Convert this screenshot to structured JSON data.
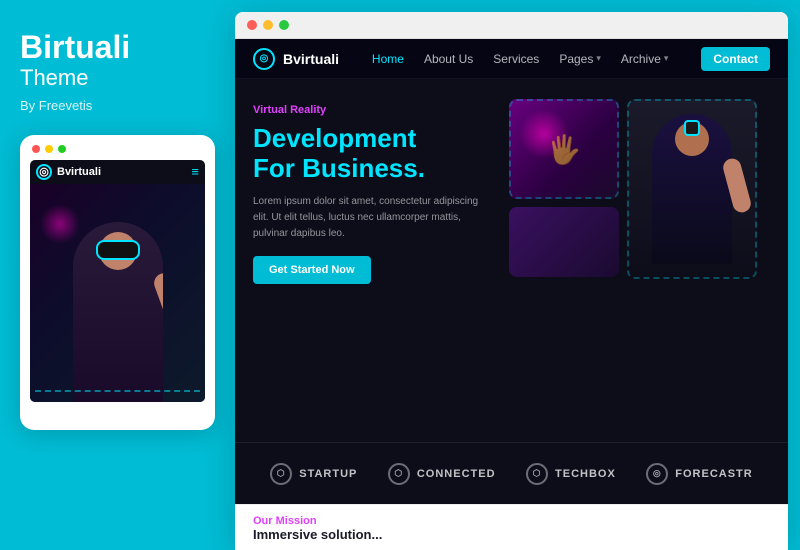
{
  "left": {
    "brand_title": "Birtuali",
    "brand_sub": "Theme",
    "by_line": "By Freevetis",
    "mobile_dots": [
      "dot-red",
      "dot-yellow",
      "dot-green"
    ],
    "mobile_logo": "Bvirtuali"
  },
  "browser": {
    "dots": [
      "red",
      "yellow",
      "green"
    ]
  },
  "nav": {
    "logo": "Bvirtuali",
    "links": [
      {
        "label": "Home",
        "active": true
      },
      {
        "label": "About Us",
        "active": false
      },
      {
        "label": "Services",
        "active": false
      },
      {
        "label": "Pages",
        "active": false,
        "arrow": true
      },
      {
        "label": "Archive",
        "active": false,
        "arrow": true
      }
    ],
    "contact_btn": "Contact"
  },
  "hero": {
    "subtitle": "Virtual Reality",
    "title_line1": "Development",
    "title_line2": "For Business",
    "title_dot": ".",
    "description": "Lorem ipsum dolor sit amet, consectetur adipiscing elit. Ut elit tellus, luctus nec ullamcorper mattis, pulvinar dapibus leo.",
    "cta_label": "Get Started Now"
  },
  "partners": [
    {
      "icon": "⬡",
      "label": "STARTUP"
    },
    {
      "icon": "⬡",
      "label": "CONNECTED"
    },
    {
      "icon": "⬡",
      "label": "TECHBOX"
    },
    {
      "icon": "◎",
      "label": "forecastr"
    }
  ],
  "mission": {
    "title": "Our Mission",
    "subtitle": "Immersive solution..."
  }
}
